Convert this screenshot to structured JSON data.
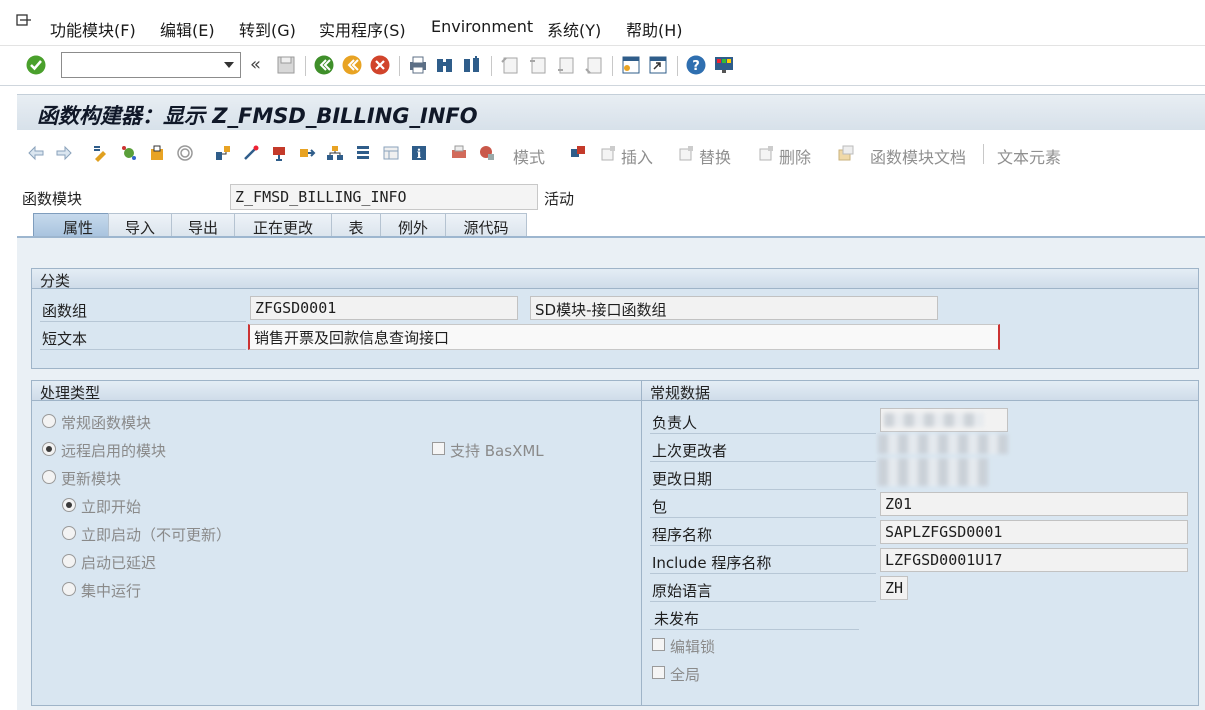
{
  "menu": {
    "items": [
      "功能模块(F)",
      "编辑(E)",
      "转到(G)",
      "实用程序(S)",
      "Environment",
      "系统(Y)",
      "帮助(H)"
    ]
  },
  "toolbar": {
    "command_value": "",
    "icons": [
      "enter-icon",
      "back-icon",
      "save-icon",
      "back-green-icon",
      "exit-icon",
      "cancel-icon",
      "print-icon",
      "find-icon",
      "find-next-icon",
      "first-page-icon",
      "prev-page-icon",
      "next-page-icon",
      "last-page-icon",
      "new-session-icon",
      "shortcut-icon",
      "help-icon",
      "customize-icon"
    ]
  },
  "title": "函数构建器：显示 Z_FMSD_BILLING_INFO",
  "app_toolbar": {
    "mode_label": "模式",
    "insert_label": "插入",
    "replace_label": "替换",
    "delete_label": "删除",
    "doc_label": "函数模块文档",
    "text_label": "文本元素"
  },
  "header": {
    "label": "函数模块",
    "value": "Z_FMSD_BILLING_INFO",
    "status": "活动"
  },
  "tabs": [
    "属性",
    "导入",
    "导出",
    "正在更改",
    "表",
    "例外",
    "源代码"
  ],
  "classification": {
    "title": "分类",
    "group_label": "函数组",
    "group_value": "ZFGSD0001",
    "group_desc": "SD模块-接口函数组",
    "short_text_label": "短文本",
    "short_text_value": "销售开票及回款信息查询接口"
  },
  "processing": {
    "title": "处理类型",
    "normal": "常规函数模块",
    "remote": "远程启用的模块",
    "basxml": "支持 BasXML",
    "update": "更新模块",
    "immediate": "立即开始",
    "immediate_no_update": "立即启动（不可更新）",
    "delayed": "启动已延迟",
    "collective": "集中运行"
  },
  "general": {
    "title": "常规数据",
    "owner_label": "负责人",
    "last_changed_by_label": "上次更改者",
    "changed_on_label": "更改日期",
    "package_label": "包",
    "package_value": "Z01",
    "program_label": "程序名称",
    "program_value": "SAPLZFGSD0001",
    "include_label": "Include 程序名称",
    "include_value": "LZFGSD0001U17",
    "language_label": "原始语言",
    "language_value": "ZH",
    "unreleased": "未发布",
    "edit_lock": "编辑锁",
    "global": "全局"
  }
}
